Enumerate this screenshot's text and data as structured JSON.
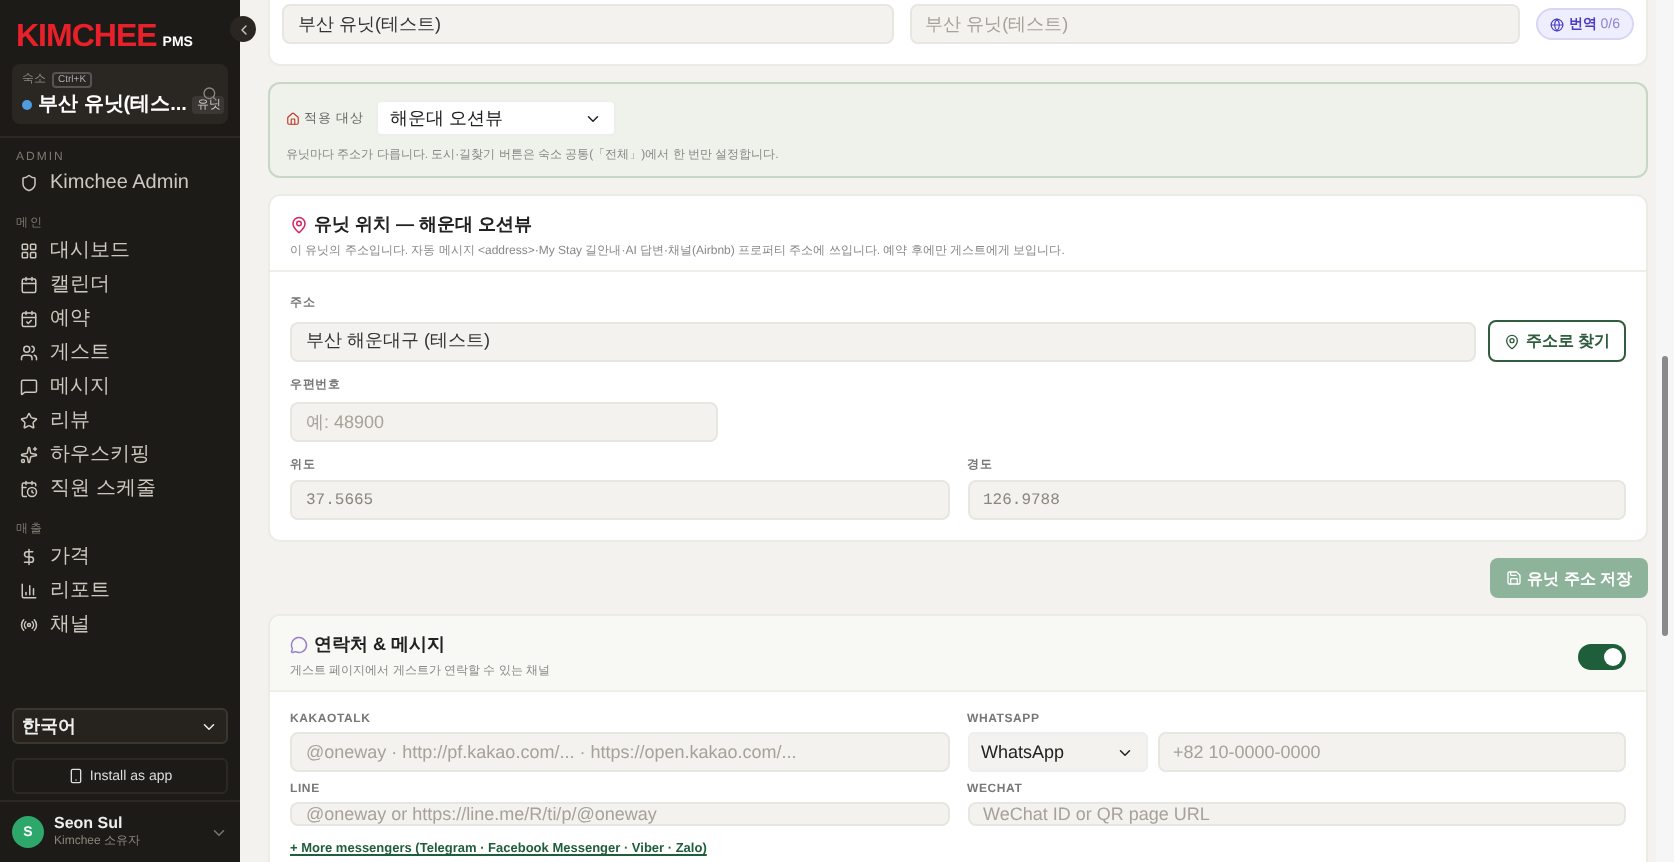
{
  "sidebar": {
    "logo": "KIMCHEE",
    "logo_suffix": "PMS",
    "property": {
      "label": "숙소",
      "shortcut": "Ctrl+K",
      "name": "부산 유닛(테스...",
      "badge": "유닛"
    },
    "sections": [
      {
        "title": "ADMIN",
        "items": [
          {
            "label": "Kimchee Admin",
            "selected": false
          }
        ]
      },
      {
        "title": "메인",
        "items": [
          {
            "label": "대시보드",
            "selected": false
          },
          {
            "label": "캘린더",
            "selected": false
          },
          {
            "label": "예약",
            "selected": false
          },
          {
            "label": "게스트",
            "selected": false
          },
          {
            "label": "메시지",
            "selected": false
          },
          {
            "label": "리뷰",
            "selected": false
          },
          {
            "label": "하우스키핑",
            "selected": false
          },
          {
            "label": "직원 스케줄",
            "selected": false
          }
        ]
      },
      {
        "title": "매출",
        "items": [
          {
            "label": "가격",
            "selected": false
          },
          {
            "label": "리포트",
            "selected": false
          },
          {
            "label": "채널",
            "selected": false
          }
        ]
      }
    ],
    "language": "한국어",
    "install": "Install as app",
    "user": {
      "initial": "S",
      "name": "Seon Sul",
      "role": "Kimchee 소유자"
    }
  },
  "name_card": {
    "value": "부산 유닛(테스트)",
    "translation_placeholder": "부산 유닛(테스트)",
    "translate_button": "번역",
    "translate_count": "0/6"
  },
  "scope_card": {
    "label": "적용 대상",
    "selected": "해운대 오션뷰",
    "note": "유닛마다 주소가 다릅니다. 도시·길찾기 버튼은 숙소 공통(「전체」)에서 한 번만 설정합니다."
  },
  "location_card": {
    "title": "유닛 위치 — 해운대 오션뷰",
    "description": "이 유닛의 주소입니다. 자동 메시지 <address>·My Stay 길안내·AI 답변·채널(Airbnb) 프로퍼티 주소에 쓰입니다. 예약 후에만 게스트에게 보입니다.",
    "address_label": "주소",
    "address": "부산 해운대구 (테스트)",
    "find_button": "주소로 찾기",
    "postal_label": "우편번호",
    "postal_placeholder": "예: 48900",
    "lat_label": "위도",
    "lat": "37.5665",
    "lng_label": "경도",
    "lng": "126.9788"
  },
  "save_button": "유닛 주소 저장",
  "contact_card": {
    "title": "연락처 & 메시지",
    "description": "게스트 페이지에서 게스트가 연락할 수 있는 채널",
    "on": true,
    "fields": [
      {
        "label": "KAKAOTALK",
        "kind": "text",
        "placeholder": "@oneway · http://pf.kakao.com/... · https://open.kakao.com/..."
      },
      {
        "label": "WHATSAPP",
        "kind": "select",
        "option": "WhatsApp",
        "placeholder": "+82 10-0000-0000"
      },
      {
        "label": "LINE",
        "kind": "text",
        "placeholder": "@oneway or https://line.me/R/ti/p/@oneway"
      },
      {
        "label": "WECHAT",
        "kind": "text",
        "placeholder": "WeChat ID or QR page URL"
      }
    ],
    "more_link": "+ More messengers (Telegram · Facebook Messenger · Viber · Zalo)"
  }
}
